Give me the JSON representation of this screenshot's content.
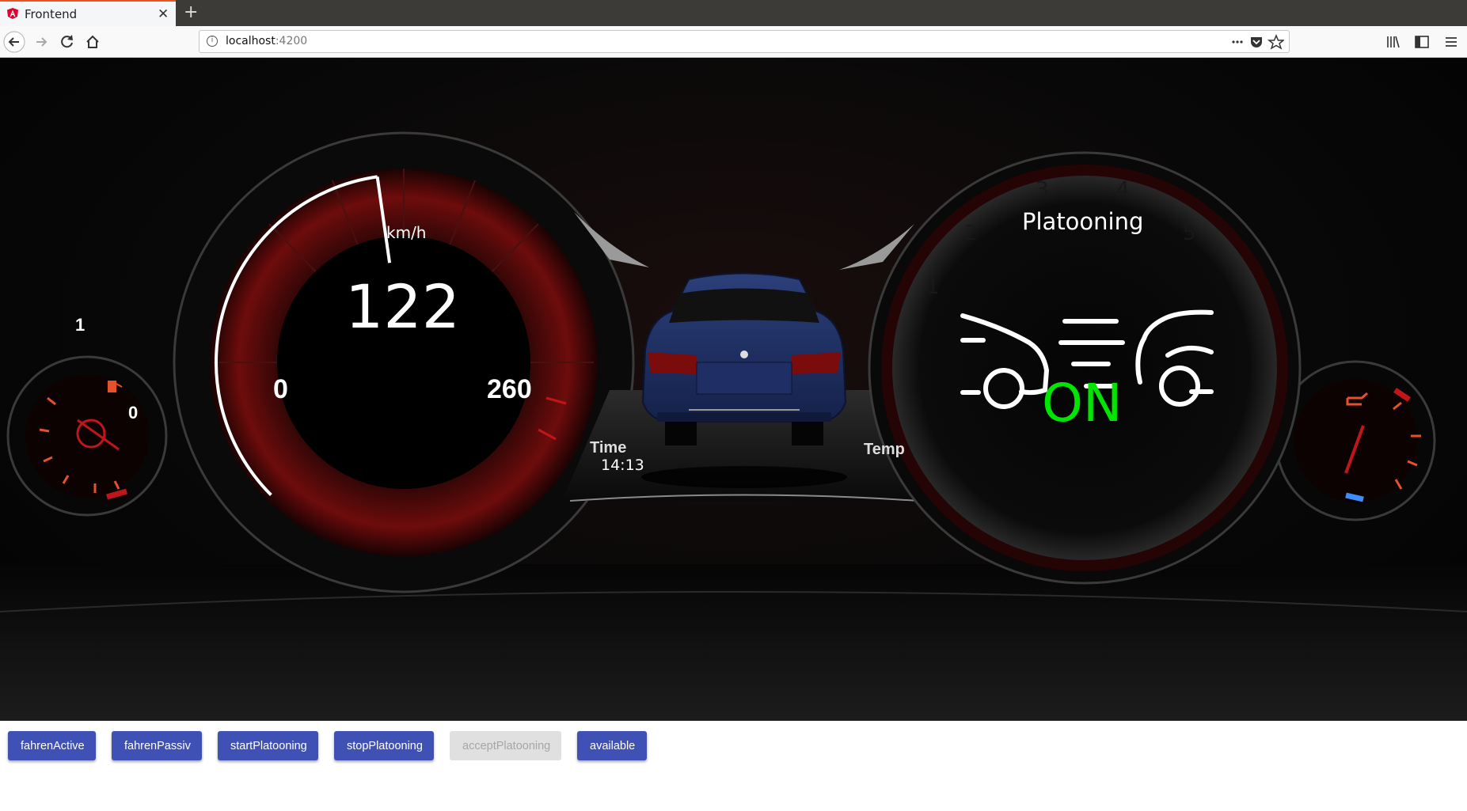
{
  "browser": {
    "tab_title": "Frontend",
    "url_host": "localhost",
    "url_port": ":4200"
  },
  "dashboard": {
    "speed": {
      "value": "122",
      "unit": "km/h",
      "min_label": "0",
      "max_label": "260",
      "fraction": 0.47
    },
    "fuel_gauge": {
      "max_label": "1",
      "min_label": "0"
    },
    "time": {
      "label": "Time",
      "value": "14:13"
    },
    "temp": {
      "label": "Temp"
    },
    "platooning": {
      "title": "Platooning",
      "status": "ON",
      "status_color": "#00e600"
    }
  },
  "buttons": {
    "fahren_active": "fahrenActive",
    "fahren_passiv": "fahrenPassiv",
    "start_platooning": "startPlatooning",
    "stop_platooning": "stopPlatooning",
    "accept_platooning": "acceptPlatooning",
    "available": "available"
  },
  "colors": {
    "accent": "#3f51b5",
    "gauge_red": "#c0161b"
  }
}
